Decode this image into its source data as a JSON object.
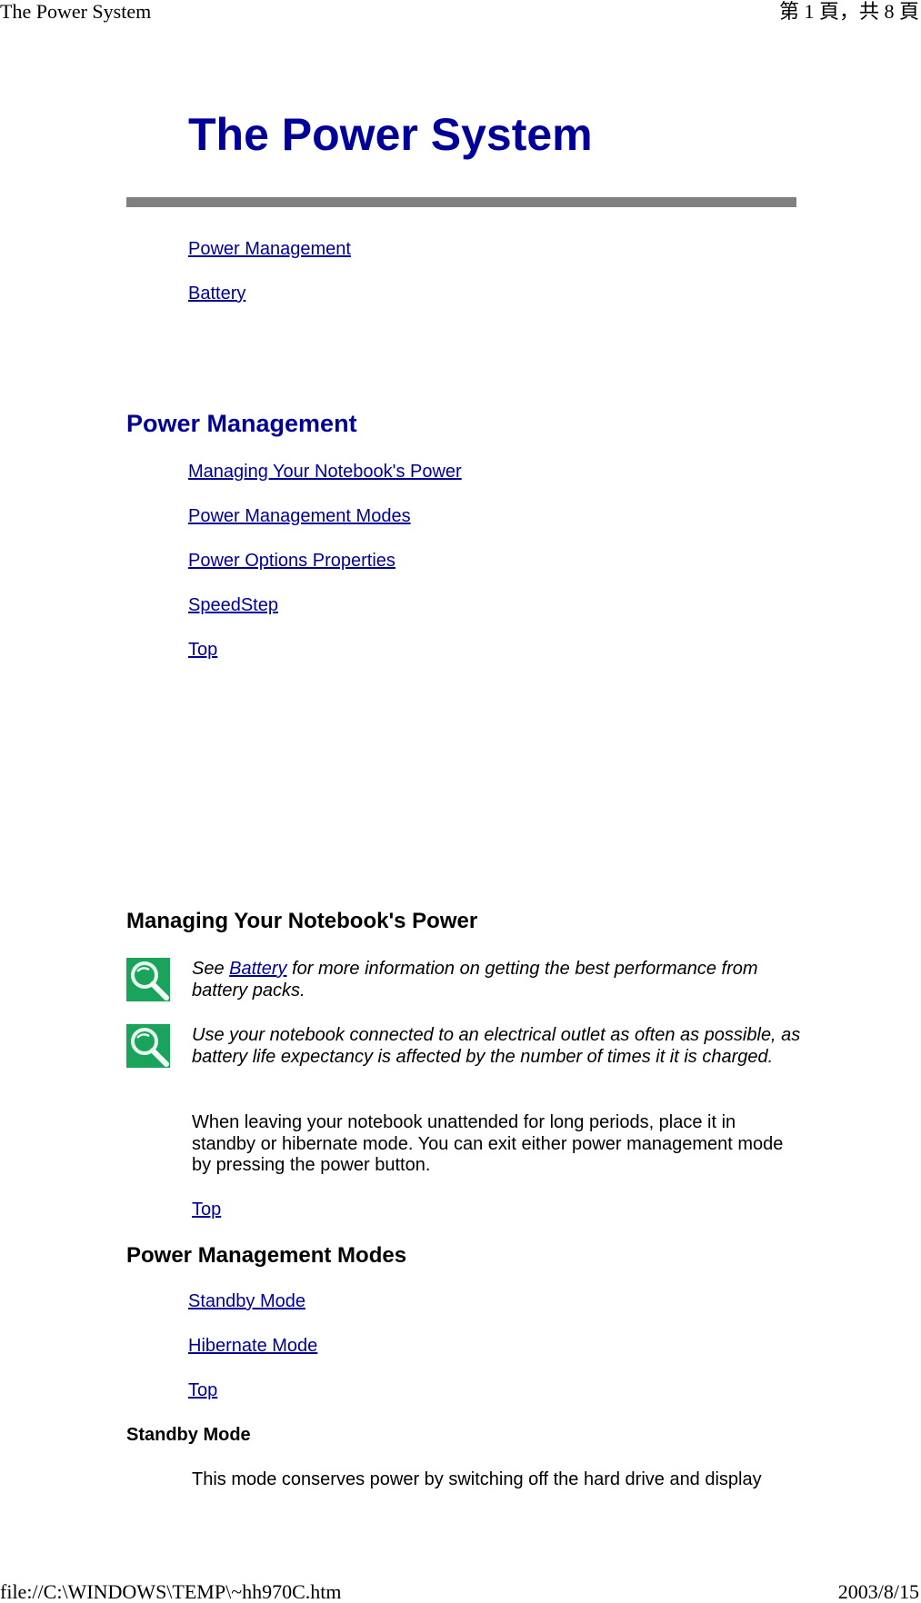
{
  "print_header": {
    "left": "The Power System",
    "right": "第 1 頁，共 8 頁"
  },
  "print_footer": {
    "left": "file://C:\\WINDOWS\\TEMP\\~hh970C.htm",
    "right": "2003/8/15"
  },
  "page": {
    "title": "The Power System",
    "toc": [
      "Power Management",
      "Battery"
    ]
  },
  "power_management": {
    "heading": "Power Management",
    "links": [
      "Managing Your Notebook's Power",
      "Power Management Modes",
      "Power Options Properties",
      "SpeedStep",
      "Top"
    ]
  },
  "managing": {
    "heading": "Managing Your Notebook's Power",
    "note1": {
      "prefix": "See ",
      "link": "Battery",
      "suffix": " for more information on getting the best performance from battery packs."
    },
    "note2": "Use your notebook connected to an electrical outlet as often as possible, as battery life expectancy is affected by the number of times it it is charged.",
    "paragraph": "When leaving your notebook unattended for long periods, place it in standby or hibernate mode. You can exit either power management mode by pressing the power button.",
    "top_link": "Top"
  },
  "modes": {
    "heading": "Power Management Modes",
    "links": [
      "Standby Mode",
      "Hibernate Mode",
      "Top"
    ]
  },
  "standby": {
    "heading": "Standby Mode",
    "text": "This mode conserves power by switching off the hard drive and display"
  },
  "icons": {
    "note_icon": "magnifier-icon"
  },
  "colors": {
    "link": "#000099",
    "heading": "#000099",
    "rule": "#808080",
    "note_icon_bg": "#1aa35a"
  }
}
